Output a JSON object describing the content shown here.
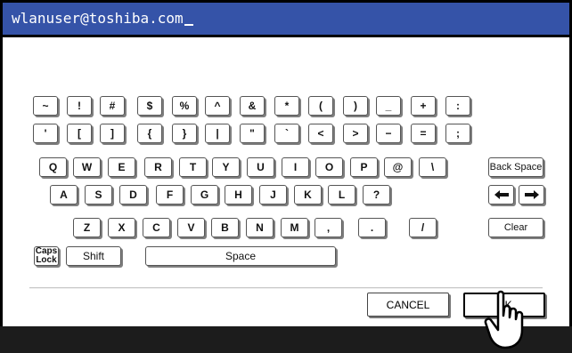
{
  "input": {
    "value": "wlanuser@toshiba.com"
  },
  "keyboard": {
    "row1": [
      "~",
      "!",
      "#",
      "$",
      "%",
      "^",
      "&",
      "*",
      "(",
      ")",
      "_",
      "+",
      ":"
    ],
    "row2": [
      "'",
      "[",
      "]",
      "{",
      "}",
      "|",
      "\"",
      "`",
      "<",
      ">",
      "−",
      "=",
      ";"
    ],
    "row3": [
      "Q",
      "W",
      "E",
      "R",
      "T",
      "Y",
      "U",
      "I",
      "O",
      "P",
      "@",
      "\\"
    ],
    "row4": [
      "A",
      "S",
      "D",
      "F",
      "G",
      "H",
      "J",
      "K",
      "L",
      "?"
    ],
    "row5": [
      "Z",
      "X",
      "C",
      "V",
      "B",
      "N",
      "M",
      ",",
      ".",
      "/"
    ],
    "backspace_label": "Back Space",
    "clear_label": "Clear",
    "caps_label_line1": "Caps",
    "caps_label_line2": "Lock",
    "shift_label": "Shift",
    "space_label": "Space"
  },
  "actions": {
    "cancel_label": "CANCEL",
    "ok_label": "OK"
  },
  "colors": {
    "title_bar": "#3553a8",
    "frame": "#000000",
    "bottom_bar": "#1c1c1c"
  },
  "icons": {
    "left_arrow": "arrow-left-icon",
    "right_arrow": "arrow-right-icon",
    "pointer": "hand-pointer-icon"
  }
}
